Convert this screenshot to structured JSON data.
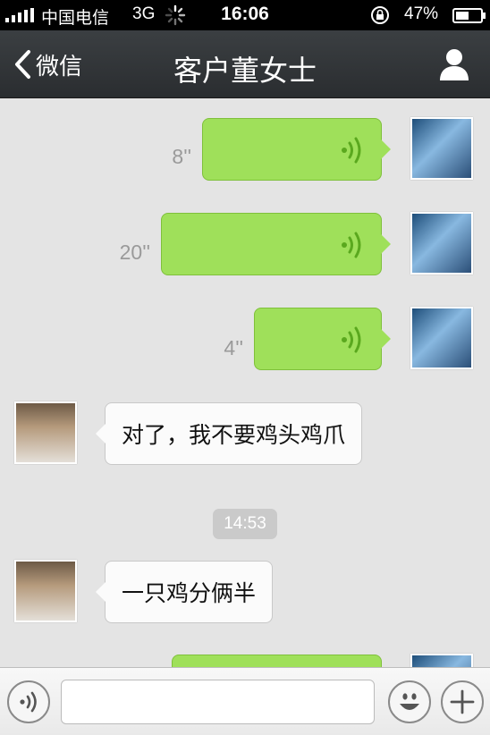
{
  "status_bar": {
    "carrier": "中国电信",
    "network": "3G",
    "time": "16:06",
    "battery_percent": "47%",
    "icons": [
      "signal-icon",
      "loading-spinner-icon",
      "rotation-lock-icon",
      "battery-icon"
    ]
  },
  "nav": {
    "back_label": "微信",
    "title": "客户董女士",
    "right_icon": "person-icon"
  },
  "messages": [
    {
      "sender": "me",
      "type": "voice",
      "duration": "8''"
    },
    {
      "sender": "me",
      "type": "voice",
      "duration": "20''"
    },
    {
      "sender": "me",
      "type": "voice",
      "duration": "4''"
    },
    {
      "sender": "other",
      "type": "text",
      "text": "对了，我不要鸡头鸡爪"
    },
    {
      "type": "timestamp",
      "text": "14:53"
    },
    {
      "sender": "other",
      "type": "text",
      "text": "一只鸡分俩半"
    },
    {
      "sender": "me",
      "type": "voice",
      "duration": ""
    }
  ],
  "input_bar": {
    "left_icon": "voice-mode-icon",
    "input_value": "",
    "emoji_icon": "emoji-icon",
    "plus_icon": "plus-icon"
  },
  "colors": {
    "voice_bubble": "#9fe05a",
    "text_bubble": "#fbfbfb",
    "nav_bar": "#2f3336",
    "chat_background": "#e4e4e4"
  }
}
